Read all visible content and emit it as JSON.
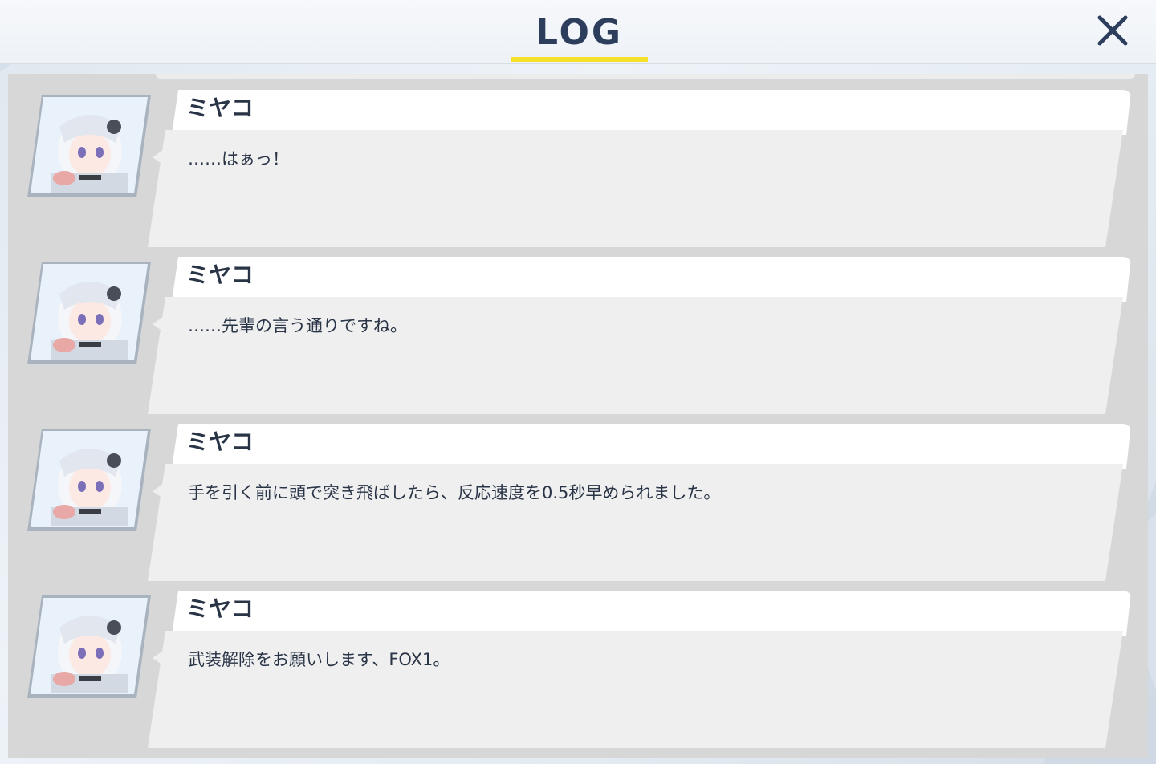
{
  "header": {
    "title": "LOG",
    "accent_color": "#f3e12c",
    "title_color": "#2c3e5c",
    "close_icon": "close-icon"
  },
  "log": {
    "entries": [
      {
        "speaker": "ミヤコ",
        "message": "……はぁっ！"
      },
      {
        "speaker": "ミヤコ",
        "message": "……先輩の言う通りですね。"
      },
      {
        "speaker": "ミヤコ",
        "message": "手を引く前に頭で突き飛ばしたら、反応速度を0.5秒早められました。"
      },
      {
        "speaker": "ミヤコ",
        "message": "武装解除をお願いします、FOX1。"
      }
    ]
  }
}
